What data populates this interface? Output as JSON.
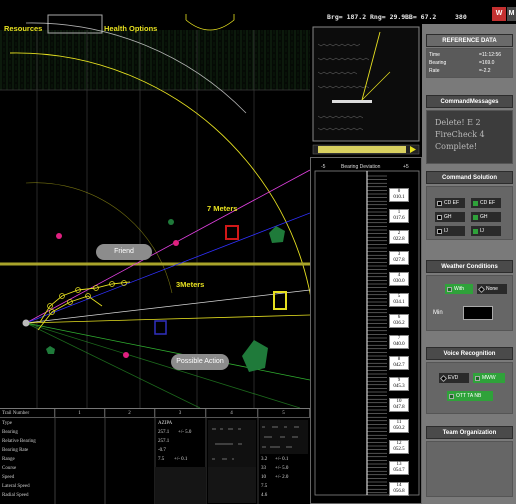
{
  "top": {
    "brg": "Brg= 187.2",
    "rng": "Rng= 29.9",
    "bb": "BB= 67.2",
    "num": "380",
    "btn_w": "W",
    "btn_m": "M"
  },
  "tactical": {
    "resources_label": "Resources",
    "health_label": "Health Options",
    "range7": "7 Meters",
    "range3": "3Meters",
    "friend_button": "Friend",
    "possible_action_button": "Possible Action"
  },
  "bearing": {
    "left": "-5",
    "title": "Bearing Deviation",
    "right": "+5",
    "ticks": [
      {
        "n": "0",
        "v": "010.1"
      },
      {
        "n": "1",
        "v": "017.6"
      },
      {
        "n": "2",
        "v": "022.8"
      },
      {
        "n": "3",
        "v": "027.8"
      },
      {
        "n": "4",
        "v": "030.0"
      },
      {
        "n": "5",
        "v": "034.1"
      },
      {
        "n": "6",
        "v": "036.2"
      },
      {
        "n": "7",
        "v": "040.0"
      },
      {
        "n": "8",
        "v": "042.7"
      },
      {
        "n": "9",
        "v": "045.3"
      },
      {
        "n": "10",
        "v": "047.8"
      },
      {
        "n": "11",
        "v": "050.2"
      },
      {
        "n": "12",
        "v": "052.5"
      },
      {
        "n": "13",
        "v": "054.7"
      },
      {
        "n": "14",
        "v": "056.8"
      }
    ]
  },
  "right": {
    "reference_title": "REFERENCE DATA",
    "ref_time_label": "Time",
    "ref_time": "=11:12:56",
    "ref_bearing_label": "Bearing",
    "ref_bearing": "=169.0",
    "ref_rate_label": "Rate",
    "ref_rate": "=-2.2",
    "command_messages_title": "CommandMessages",
    "command_messages_text": [
      "Delete!  E 2",
      "FireCheck 4",
      "Complete!"
    ],
    "command_solution_title": "Command Solution",
    "cs_buttons": [
      "CD EF",
      "CD EF",
      "GH",
      "GH",
      "IJ",
      "IJ"
    ],
    "weather_title": "Weather Conditions",
    "weather_with": "With",
    "weather_none": "None",
    "weather_min": "Min",
    "voice_title": "Voice Recognition",
    "voice_evd": "EVD",
    "voice_mww": "MWW",
    "voice_ott": "OTT TA NB",
    "team_title": "Team Organization"
  },
  "table": {
    "headers": [
      "Trail Number",
      "1",
      "2",
      "3",
      "4",
      "5"
    ],
    "rows": [
      "Type",
      "Bearing",
      "Relative Bearing",
      "Bearing Rate",
      "Range",
      "Course",
      "Speed",
      "Lateral Speed",
      "Radial Speed"
    ],
    "col3": [
      "AZIPA",
      "257.1",
      "257.1",
      "-0.7",
      "7.5",
      "",
      "",
      "",
      ""
    ],
    "col3_err": [
      "",
      "+/- 5.0",
      "",
      "",
      "+/- 0.1",
      "",
      "",
      "",
      ""
    ],
    "col5": [
      "",
      "",
      "",
      "",
      "3.2",
      "33",
      "10",
      "7.5",
      "4.6"
    ],
    "col5_err": [
      "",
      "",
      "",
      "",
      "+/- 0.1",
      "+/- 5.0",
      "+/- 2.0",
      "",
      ""
    ]
  },
  "colors": {
    "accent_yellow": "#e6e020",
    "friend_green": "#1f7a3a",
    "hostile_red": "#d01818",
    "panel_grey": "#7a7a7a",
    "panel_dark": "#4a4a4a",
    "button_green": "#2fa23a"
  }
}
